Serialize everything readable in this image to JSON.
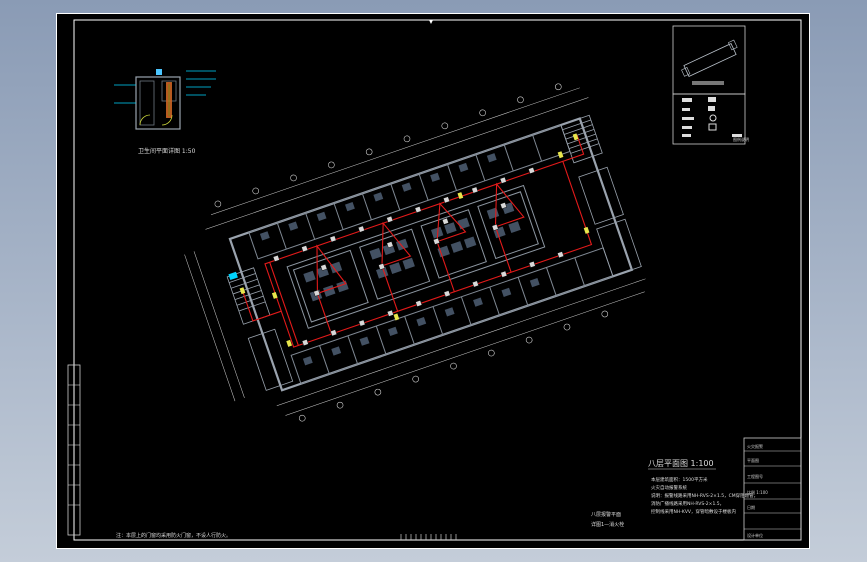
{
  "drawing": {
    "inset_scale_label": "卫生间平面详图 1:50",
    "plan_title": "八层平面图 1:100",
    "legend": {
      "symbols": [
        "烟感探测器",
        "手动报警按钮",
        "消火栓按钮",
        "声光报警器",
        "消防广播"
      ],
      "key_title": "图例说明"
    },
    "notes_lines": [
      "本层建筑面积：1500平方米",
      "火灾自动报警系统",
      "说明：报警线路采用NH-RVS-2×1.5，CM穿阻燃管，",
      "消防广播线路采用NH-RVS-2×1.5，",
      "控制线采用NH-KVV，穿管暗敷设于楼板内"
    ],
    "bottom_note": "注：本层上的门窗均采用防火门窗，不设人行防火。",
    "footer_lines": [
      "八层报警平面",
      "详图1—消火栓"
    ],
    "title_block": {
      "rows": [
        "火灾报警",
        "平面图",
        "工程图号",
        "比例 1:100",
        "日期",
        "设计单位"
      ]
    },
    "sheet_number": "图号"
  },
  "colors": {
    "background": "#000000",
    "frame": "#ffffff",
    "wiring": "#e31a1a",
    "walls": "#9aa3ae",
    "columns": "#b8c0c9",
    "device": "#e8e64c",
    "accent": "#00d4ff"
  }
}
